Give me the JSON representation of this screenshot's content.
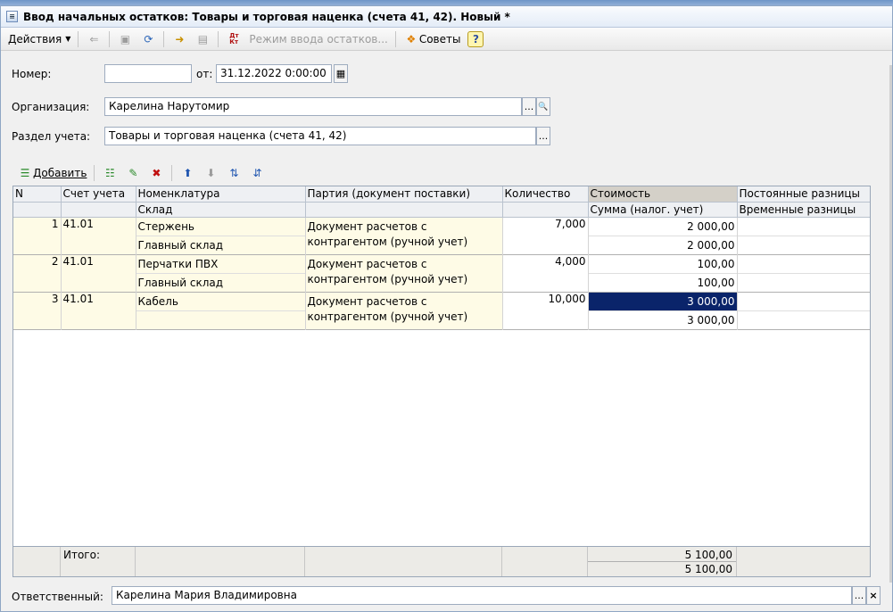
{
  "window": {
    "title": "Ввод начальных остатков: Товары и торговая наценка (счета 41, 42). Новый *"
  },
  "toolbar": {
    "actions_label": "Действия",
    "mode_label": "Режим ввода остатков...",
    "tips_label": "Советы",
    "help_label": "?",
    "dt_kt_label": "Дт\nКт"
  },
  "form": {
    "number_label": "Номер:",
    "number_value": "",
    "date_label": "от:",
    "date_value": "31.12.2022 0:00:00",
    "org_label": "Организация:",
    "org_value": "Карелина Нарутомир",
    "section_label": "Раздел учета:",
    "section_value": "Товары и торговая наценка (счета 41, 42)",
    "responsible_label": "Ответственный:",
    "responsible_value": "Карелина Мария Владимировна",
    "ellipsis": "...",
    "search_glyph": "🔍",
    "clear_glyph": "×"
  },
  "list_toolbar": {
    "add_label": "Добавить"
  },
  "table": {
    "headers_top": [
      "N",
      "Счет учета",
      "Номенклатура",
      "Партия (документ поставки)",
      "Количество",
      "Стоимость",
      "Постоянные разницы"
    ],
    "headers_bottom": [
      "",
      "",
      "Склад",
      "",
      "",
      "Сумма (налог. учет)",
      "Временные разницы"
    ],
    "rows": [
      {
        "n": "1",
        "account": "41.01",
        "item": "Стержень",
        "warehouse": "Главный склад",
        "party1": "Документ расчетов с",
        "party2": "контрагентом (ручной учет)",
        "qty": "7,000",
        "cost": "2 000,00",
        "tax_sum": "2 000,00"
      },
      {
        "n": "2",
        "account": "41.01",
        "item": "Перчатки ПВХ",
        "warehouse": "Главный склад",
        "party1": "Документ расчетов с",
        "party2": "контрагентом (ручной учет)",
        "qty": "4,000",
        "cost": "100,00",
        "tax_sum": "100,00"
      },
      {
        "n": "3",
        "account": "41.01",
        "item": "Кабель",
        "warehouse": "",
        "party1": "Документ расчетов с",
        "party2": "контрагентом (ручной учет)",
        "qty": "10,000",
        "cost": "3 000,00",
        "tax_sum": "3 000,00"
      }
    ],
    "total_label": "Итого:",
    "total_cost": "5 100,00",
    "total_tax_sum": "5 100,00"
  }
}
